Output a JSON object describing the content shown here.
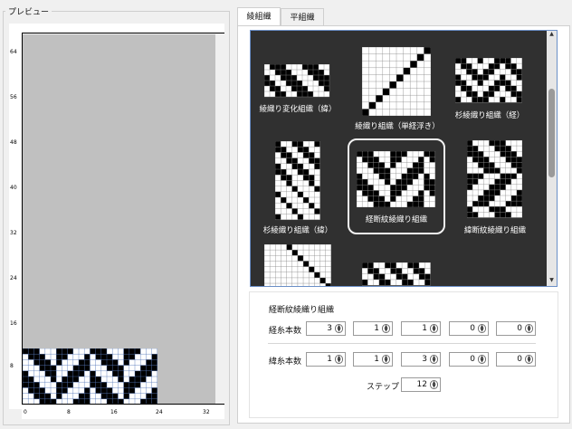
{
  "preview": {
    "title": "プレビュー"
  },
  "ruler": {
    "left_labels": [
      "64",
      "56",
      "48",
      "40",
      "32",
      "24",
      "16",
      "8"
    ],
    "bottom_labels": [
      "0",
      "8",
      "16",
      "24",
      "32"
    ]
  },
  "tabs": [
    {
      "label": "綾組織"
    },
    {
      "label": "平組織"
    }
  ],
  "gallery": {
    "tiles": [
      {
        "label": "綾織り変化組織（緯）"
      },
      {
        "label": "綾織り組織（単経浮き）"
      },
      {
        "label": "杉綾織り組織（経）"
      },
      {
        "label": "杉綾織り組織（緯）"
      },
      {
        "label": "経断紋綾織り組織"
      },
      {
        "label": "緯断紋綾織り組織"
      }
    ],
    "selected_index": 4
  },
  "params": {
    "title": "経断紋綾織り組織",
    "warp_label": "経糸本数",
    "warp_values": [
      "3",
      "1",
      "1",
      "0",
      "0"
    ],
    "weft_label": "緯糸本数",
    "weft_values": [
      "1",
      "1",
      "3",
      "0",
      "0"
    ],
    "step_label": "ステップ =",
    "step_value": "12"
  },
  "colors": {
    "gallery_bg": "#303030",
    "accent": "#6b8fc7"
  }
}
